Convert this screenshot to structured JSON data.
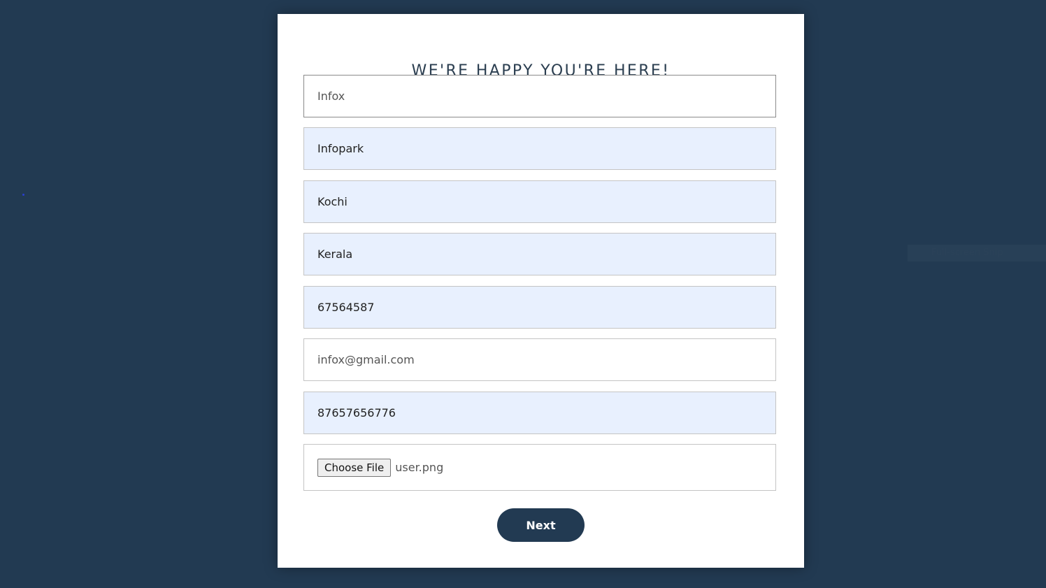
{
  "form": {
    "title": "WE'RE HAPPY YOU'RE HERE!",
    "fields": [
      {
        "value": "Infox"
      },
      {
        "value": "Infopark"
      },
      {
        "value": "Kochi"
      },
      {
        "value": "Kerala"
      },
      {
        "value": "67564587"
      },
      {
        "value": "infox@gmail.com"
      },
      {
        "value": "87657656776"
      }
    ],
    "file": {
      "button_label": "Choose File",
      "file_name": "user.png"
    },
    "next_label": "Next"
  },
  "overlay": {
    "snip_label": "Full-screen Snip"
  },
  "colors": {
    "background": "#223a52",
    "card": "#ffffff",
    "autofill": "#e8f0fe",
    "button": "#223a52"
  }
}
